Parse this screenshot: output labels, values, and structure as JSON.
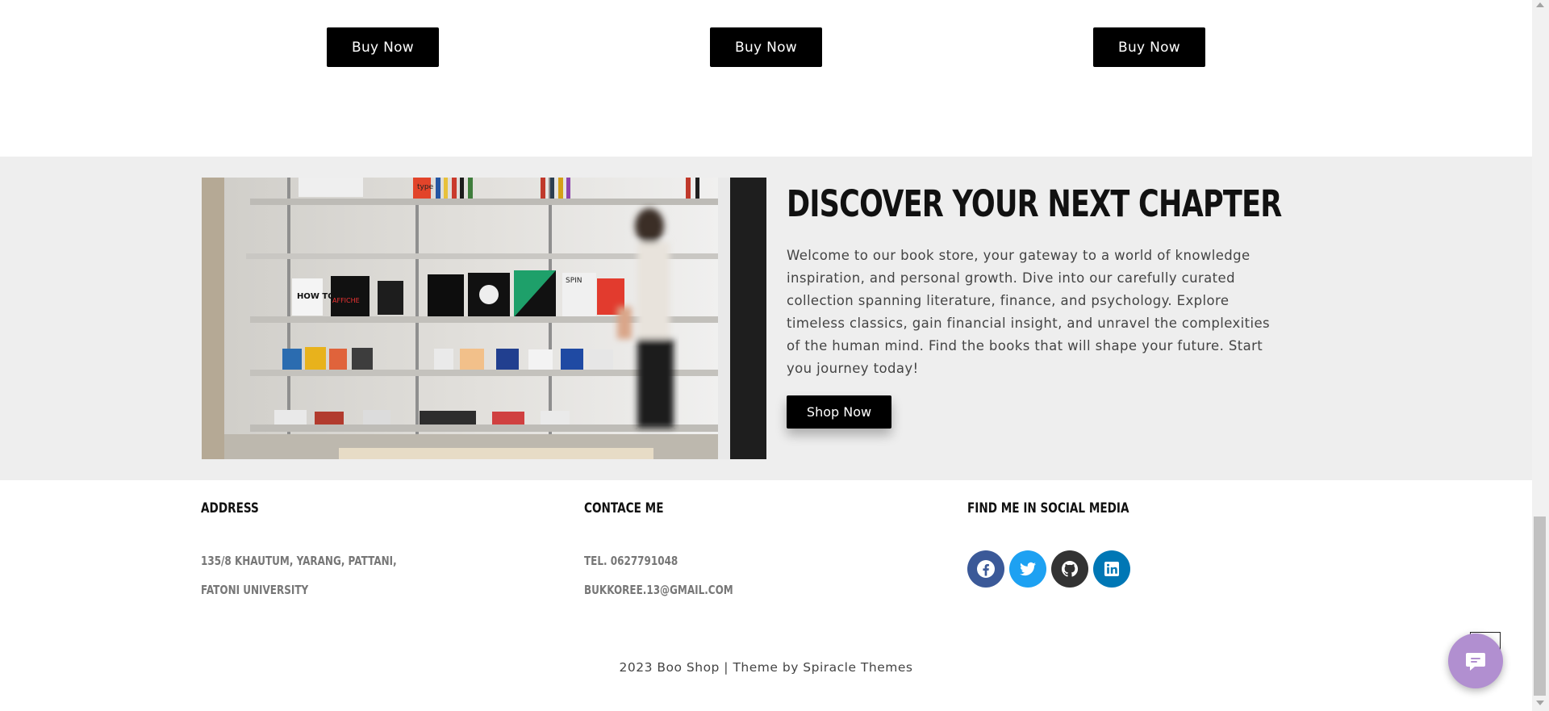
{
  "products": {
    "buy_labels": [
      "Buy Now",
      "Buy Now",
      "Buy Now"
    ]
  },
  "discover": {
    "title": "DISCOVER YOUR NEXT CHAPTER",
    "text": "Welcome to our book store, your gateway to a world of knowledge inspiration, and personal growth. Dive into our carefully curated collection spanning literature, finance, and psychology. Explore timeless classics, gain financial insight, and unravel the complexities of the human mind. Find the books that will shape your future. Start you journey today!",
    "button": "Shop Now",
    "image_book_titles": [
      "type",
      "HOW TO SEE",
      "AFFICHE",
      "SPIN"
    ]
  },
  "footer": {
    "address": {
      "heading": "ADDRESS",
      "line1": "135/8 KHAUTUM, YARANG, PATTANI,",
      "line2": "FATONI UNIVERSITY"
    },
    "contact": {
      "heading": "CONTACE ME",
      "phone": "TEL. 0627791048",
      "email": "BUKKOREE.13@GMAIL.COM"
    },
    "social": {
      "heading": "FIND ME IN SOCIAL MEDIA",
      "icons": [
        {
          "name": "facebook-icon",
          "color": "#3b5998"
        },
        {
          "name": "twitter-icon",
          "color": "#1da1f2"
        },
        {
          "name": "github-icon",
          "color": "#333333"
        },
        {
          "name": "linkedin-icon",
          "color": "#0077b5"
        }
      ]
    },
    "copyright": "2023 Boo Shop | Theme by Spiracle Themes"
  },
  "colors": {
    "button_bg": "#000000",
    "section_bg": "#eeeeee",
    "chat_widget": "#b18fd0"
  }
}
